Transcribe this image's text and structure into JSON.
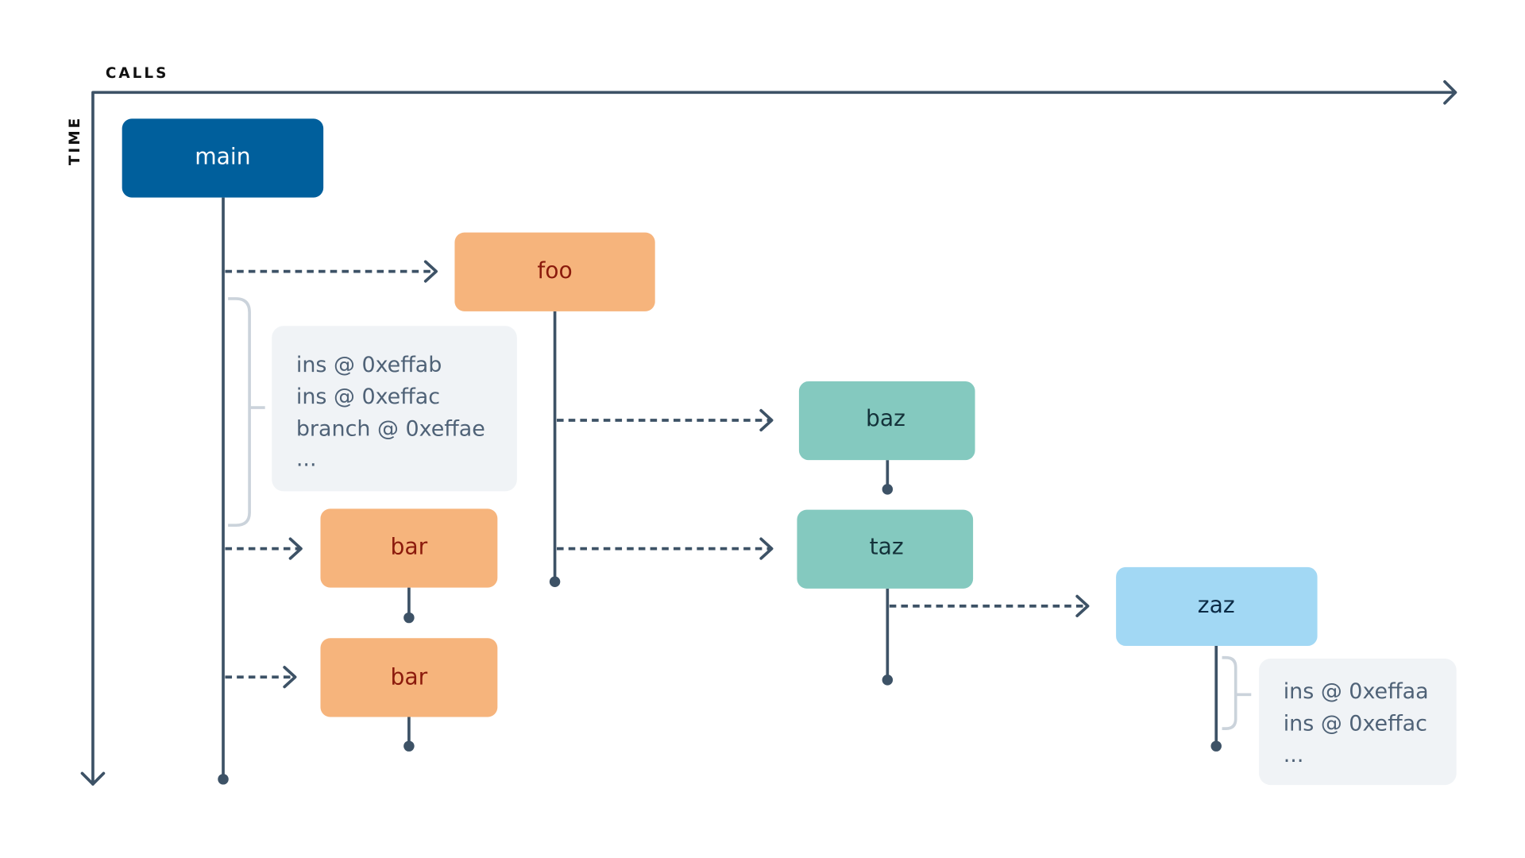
{
  "axes": {
    "x_label": "CALLS",
    "y_label": "TIME"
  },
  "colors": {
    "main_fill": "#005f9c",
    "main_text": "#ffffff",
    "orange_fill": "#f6b47c",
    "orange_text": "#8b1a0c",
    "teal_fill": "#84c9bf",
    "teal_text": "#14323a",
    "blue_fill": "#a2d8f4",
    "blue_text": "#0b2a45",
    "note_fill": "#f0f3f6",
    "line": "#3d5266"
  },
  "nodes": {
    "main": "main",
    "foo": "foo",
    "bar1": "bar",
    "bar2": "bar",
    "baz": "baz",
    "taz": "taz",
    "zaz": "zaz"
  },
  "notes": {
    "main_trace": [
      "ins @ 0xeffab",
      "ins @ 0xeffac",
      "branch @ 0xeffae",
      "..."
    ],
    "zaz_trace": [
      "ins @ 0xeffaa",
      "ins @ 0xeffac",
      "..."
    ]
  },
  "calls": [
    {
      "from": "main",
      "to": "foo"
    },
    {
      "from": "main",
      "to": "bar"
    },
    {
      "from": "main",
      "to": "bar"
    },
    {
      "from": "foo",
      "to": "baz"
    },
    {
      "from": "foo",
      "to": "taz"
    },
    {
      "from": "taz",
      "to": "zaz"
    }
  ]
}
